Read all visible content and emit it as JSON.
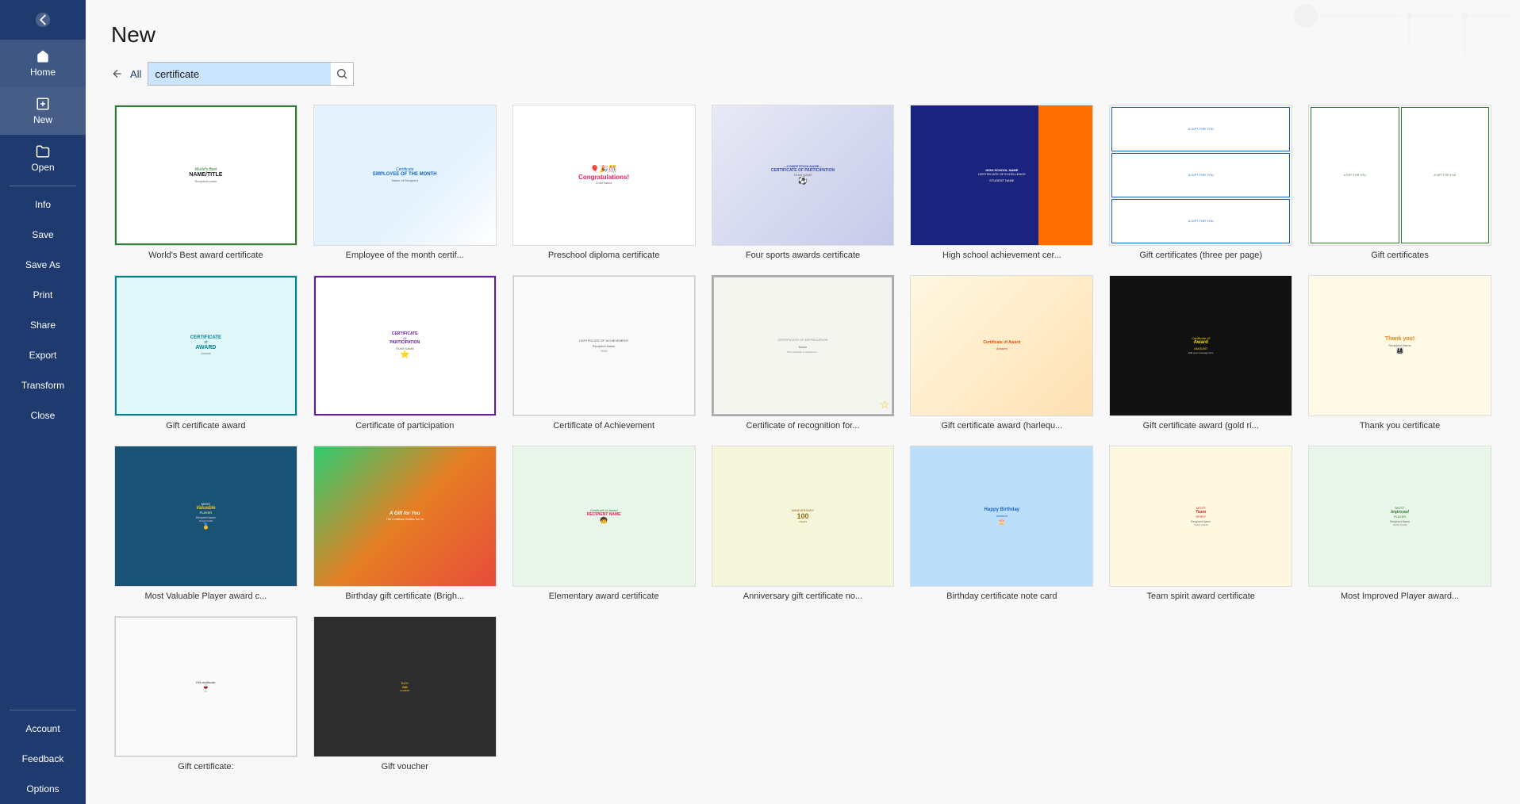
{
  "sidebar": {
    "back_icon": "←",
    "nav_items": [
      {
        "label": "Home",
        "icon": "home"
      },
      {
        "label": "New",
        "icon": "new",
        "active": true
      },
      {
        "label": "Open",
        "icon": "open"
      }
    ],
    "middle_items": [
      {
        "label": "Info"
      },
      {
        "label": "Save"
      },
      {
        "label": "Save As"
      },
      {
        "label": "Print"
      },
      {
        "label": "Share"
      },
      {
        "label": "Export"
      },
      {
        "label": "Transform"
      },
      {
        "label": "Close"
      }
    ],
    "bottom_items": [
      {
        "label": "Account"
      },
      {
        "label": "Feedback"
      },
      {
        "label": "Options"
      }
    ]
  },
  "page": {
    "title": "New",
    "search_placeholder": "certificate",
    "search_value": "certificate",
    "all_link": "All"
  },
  "templates": [
    {
      "label": "World's Best award certificate",
      "row": 1,
      "color1": "#e8f4e8",
      "color2": "#2e7d32",
      "type": "worlds_best"
    },
    {
      "label": "Employee of the month certif...",
      "row": 1,
      "color1": "#e3f2fd",
      "color2": "#1565c0",
      "type": "employee"
    },
    {
      "label": "Preschool diploma certificate",
      "row": 1,
      "color1": "#fff9e6",
      "color2": "#e91e63",
      "type": "preschool"
    },
    {
      "label": "Four sports awards certificate",
      "row": 1,
      "color1": "#e8eaf6",
      "color2": "#3949ab",
      "type": "sports"
    },
    {
      "label": "High school achievement cer...",
      "row": 1,
      "color1": "#1a237e",
      "color2": "#ff6f00",
      "type": "highschool"
    },
    {
      "label": "Gift certificates (three per page)",
      "row": 1,
      "color1": "#e8f5e9",
      "color2": "#1565c0",
      "type": "gift3"
    },
    {
      "label": "Gift certificates",
      "row": 1,
      "color1": "#e8f5e9",
      "color2": "#2e7d32",
      "type": "gift"
    },
    {
      "label": "Gift certificate award",
      "row": 2,
      "color1": "#e0f7fa",
      "color2": "#00838f",
      "type": "gift_award"
    },
    {
      "label": "Certificate of participation",
      "row": 2,
      "color1": "#f3e5f5",
      "color2": "#6a1b9a",
      "type": "participation"
    },
    {
      "label": "Certificate of Achievement",
      "row": 2,
      "color1": "#fafafa",
      "color2": "#555",
      "type": "achievement"
    },
    {
      "label": "Certificate of recognition for...",
      "row": 2,
      "color1": "#f5f5f0",
      "color2": "#888",
      "type": "recognition",
      "selected": true
    },
    {
      "label": "Gift certificate award (harlequ...",
      "row": 2,
      "color1": "#fff8e1",
      "color2": "#e65100",
      "type": "harlequin"
    },
    {
      "label": "Gift certificate award (gold ri...",
      "row": 2,
      "color1": "#111",
      "color2": "#ffd700",
      "type": "goldrib"
    },
    {
      "label": "Thank you certificate",
      "row": 2,
      "color1": "#fff9e6",
      "color2": "#f57f17",
      "type": "thankyou"
    },
    {
      "label": "Most Valuable Player award c...",
      "row": 3,
      "color1": "#1a5276",
      "color2": "#c0392b",
      "type": "mvp"
    },
    {
      "label": "Birthday gift certificate (Brigh...",
      "row": 3,
      "color1": "#2ecc71",
      "color2": "#e67e22",
      "type": "birthday_gift"
    },
    {
      "label": "Elementary award certificate",
      "row": 3,
      "color1": "#e8f5e9",
      "color2": "#e91e63",
      "type": "elementary"
    },
    {
      "label": "Anniversary gift certificate no...",
      "row": 3,
      "color1": "#f5f5dc",
      "color2": "#8b6914",
      "type": "anniversary"
    },
    {
      "label": "Birthday certificate note card",
      "row": 3,
      "color1": "#bbdefb",
      "color2": "#1565c0",
      "type": "birthday_note"
    },
    {
      "label": "Team spirit award certificate",
      "row": 3,
      "color1": "#fff8e1",
      "color2": "#c62828",
      "type": "team_spirit"
    },
    {
      "label": "Most Improved Player award...",
      "row": 3,
      "color1": "#e8f5e9",
      "color2": "#2e7d32",
      "type": "most_improved"
    },
    {
      "label": "Gift certificate:",
      "row": 4,
      "color1": "#fafafa",
      "color2": "#c0392b",
      "type": "gift_bottom"
    },
    {
      "label": "Gift voucher",
      "row": 4,
      "color1": "#2d2d2d",
      "color2": "#f1c40f",
      "type": "gift_voucher"
    }
  ]
}
